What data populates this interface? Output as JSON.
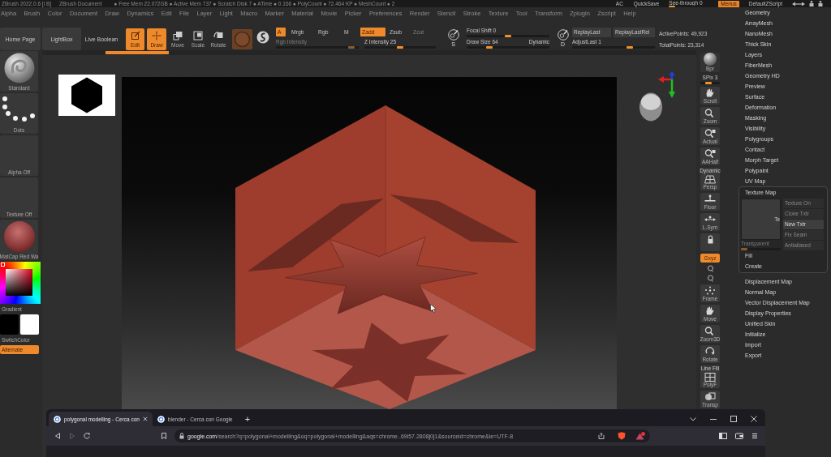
{
  "title_bar": {
    "app": "ZBrush 2022.0.6 [i B]",
    "document": "ZBrush Document",
    "stats": "● Free Mem 22.072GB ● Active Mem 737 ● Scratch Disk 7 ● ATime ● 0.166 ● PolyCount ● 72.464 KP ● MeshCount ● 2",
    "ac": "AC",
    "quicksave": "QuickSave",
    "see_through": {
      "label": "See-through 0",
      "level": 0
    },
    "menus": {
      "label": "Menus",
      "selected": true
    },
    "script": "DefaultZScript"
  },
  "menu_bar": [
    "Alpha",
    "Brush",
    "Color",
    "Document",
    "Draw",
    "Dynamics",
    "Edit",
    "File",
    "Layer",
    "Light",
    "Macro",
    "Marker",
    "Material",
    "Movie",
    "Picker",
    "Preferences",
    "Render",
    "Stencil",
    "Stroke",
    "Texture",
    "Tool",
    "Transform",
    "Zplugin",
    "Zscript",
    "Help"
  ],
  "top_shelf": {
    "nav_buttons": [
      {
        "label": "Home Page",
        "kind": "button"
      },
      {
        "label": "LightBox",
        "kind": "button"
      },
      {
        "label": "Live Boolean",
        "kind": "plain"
      }
    ],
    "tools": [
      {
        "label": "Edit",
        "kind": "edit",
        "selected": true
      },
      {
        "label": "Draw",
        "kind": "draw",
        "selected": true
      },
      {
        "label": "Move",
        "kind": "move",
        "selected": false
      },
      {
        "label": "Scale",
        "kind": "scale",
        "selected": false
      },
      {
        "label": "Rotate",
        "kind": "rotate",
        "selected": false
      }
    ],
    "color_modes": [
      {
        "label": "A",
        "selected": true
      },
      {
        "label": "Mrgb",
        "selected": false
      },
      {
        "label": "Rgb",
        "selected": false
      },
      {
        "label": "M",
        "selected": false
      }
    ],
    "depth_modes": [
      {
        "label": "Zadd",
        "selected": true,
        "disabled": false
      },
      {
        "label": "Zsub",
        "selected": false,
        "disabled": false
      },
      {
        "label": "Zcut",
        "selected": false,
        "disabled": true
      }
    ],
    "intensity_sliders": [
      {
        "label": "Rgb Intensity",
        "disabled": true,
        "level": 0.95
      },
      {
        "label": "Z Intensity 25",
        "disabled": false,
        "level": 0.5
      }
    ],
    "brush": {
      "badge": "S",
      "sliders": [
        {
          "label": "Focal Shift 0",
          "level": 0.5
        },
        {
          "label": "Draw Size 64",
          "level": 0.26,
          "tag": "Dynamic"
        }
      ]
    },
    "replay": {
      "badge": "D",
      "buttons": [
        "ReplayLast",
        "ReplayLastRel"
      ],
      "slider": {
        "label": "AdjustLast 1",
        "level": 0.71
      }
    },
    "stats": [
      "ActivePoints: 49,923",
      "TotalPoints: 23,314"
    ]
  },
  "left_shelf": {
    "thumbs": [
      {
        "label": "Standard",
        "kind": "brush"
      },
      {
        "label": "Dots",
        "kind": "stroke"
      },
      {
        "label": "Alpha Off",
        "kind": "blank"
      },
      {
        "label": "Texture Off",
        "kind": "blank"
      },
      {
        "label": "MatCap Red Wa",
        "kind": "material"
      }
    ],
    "gradient": "Gradient",
    "swatches": [
      {
        "color": "#000000"
      },
      {
        "color": "#ffffff"
      }
    ],
    "switch_color": "SwitchColor",
    "alternate": {
      "label": "Alternate",
      "on": true
    }
  },
  "right_shelf": [
    {
      "kind": "sphere",
      "label": "Bpr"
    },
    {
      "kind": "slider",
      "label": "SPix 3",
      "level": 0.35
    },
    {
      "kind": "scroll",
      "label": "Scroll"
    },
    {
      "kind": "zoom",
      "label": "Zoom"
    },
    {
      "kind": "actual",
      "label": "Actual"
    },
    {
      "kind": "aahalf",
      "label": "AAHalf"
    },
    {
      "kind": "persp",
      "label": "Persp",
      "tag": "Dynamic"
    },
    {
      "kind": "floor",
      "label": "Floor"
    },
    {
      "kind": "lsym",
      "label": "L.Sym"
    },
    {
      "kind": "lock"
    },
    {
      "kind": "toggle",
      "label": "Gxyz",
      "on": true
    },
    {
      "kind": "small"
    },
    {
      "kind": "small"
    },
    {
      "kind": "frame",
      "label": "Frame"
    },
    {
      "kind": "move",
      "label": "Move"
    },
    {
      "kind": "zoom3d",
      "label": "Zoom3D"
    },
    {
      "kind": "rotate",
      "label": "Rotate"
    },
    {
      "kind": "polyf",
      "label": "PolyF",
      "tag": "Line Fill"
    },
    {
      "kind": "transp",
      "label": "Transp"
    }
  ],
  "tool_palette": {
    "items": [
      {
        "label": "Geometry",
        "expanded": false
      },
      {
        "label": "ArrayMesh",
        "expanded": false
      },
      {
        "label": "NanoMesh",
        "expanded": false
      },
      {
        "label": "Thick Skin",
        "expanded": false
      },
      {
        "label": "Layers",
        "expanded": false
      },
      {
        "label": "FiberMesh",
        "expanded": false
      },
      {
        "label": "Geometry HD",
        "expanded": false
      },
      {
        "label": "Preview",
        "expanded": false
      },
      {
        "label": "Surface",
        "expanded": false
      },
      {
        "label": "Deformation",
        "expanded": false
      },
      {
        "label": "Masking",
        "expanded": false
      },
      {
        "label": "Visibility",
        "expanded": false
      },
      {
        "label": "Polygroups",
        "expanded": false
      },
      {
        "label": "Contact",
        "expanded": false
      },
      {
        "label": "Morph Target",
        "expanded": false
      },
      {
        "label": "Polypaint",
        "expanded": false
      },
      {
        "label": "UV Map",
        "expanded": false
      },
      {
        "label": "Texture Map",
        "expanded": true,
        "panel": {
          "thumbnail_label": "Te",
          "buttons": [
            {
              "label": "Texture On",
              "disabled": true
            },
            {
              "label": "Clone Txtr",
              "disabled": true
            },
            {
              "label": "New Txtr",
              "disabled": false
            },
            {
              "label": "Fix Seam",
              "disabled": true
            },
            {
              "label": "Antialiased",
              "disabled": true
            }
          ],
          "transparent": {
            "label": "Transparent",
            "disabled": true,
            "level": 0
          },
          "actions": [
            "Fill",
            "Create"
          ]
        }
      },
      {
        "label": "Displacement Map",
        "expanded": false
      },
      {
        "label": "Normal Map",
        "expanded": false
      },
      {
        "label": "Vector Displacement Map",
        "expanded": false
      },
      {
        "label": "Display Properties",
        "expanded": false
      },
      {
        "label": "Unified Skin",
        "expanded": false
      },
      {
        "label": "Initialize",
        "expanded": false
      },
      {
        "label": "Import",
        "expanded": false
      },
      {
        "label": "Export",
        "expanded": false
      }
    ]
  },
  "browser": {
    "tabs": [
      {
        "title": "polygonal modelling - Cerca con",
        "selected": true
      },
      {
        "title": "blender - Cerca con Google",
        "selected": false
      }
    ],
    "new_tab": "+",
    "nav": [
      {
        "kind": "back",
        "disabled": false
      },
      {
        "kind": "forward",
        "disabled": true
      },
      {
        "kind": "reload",
        "disabled": false
      }
    ],
    "address": "**google.com**/search?q=polygonal+modelling&oq=polygonal+modelling&aqs=chrome..69i57.2808j0j1&sourceid=chrome&ie=UTF-8"
  }
}
